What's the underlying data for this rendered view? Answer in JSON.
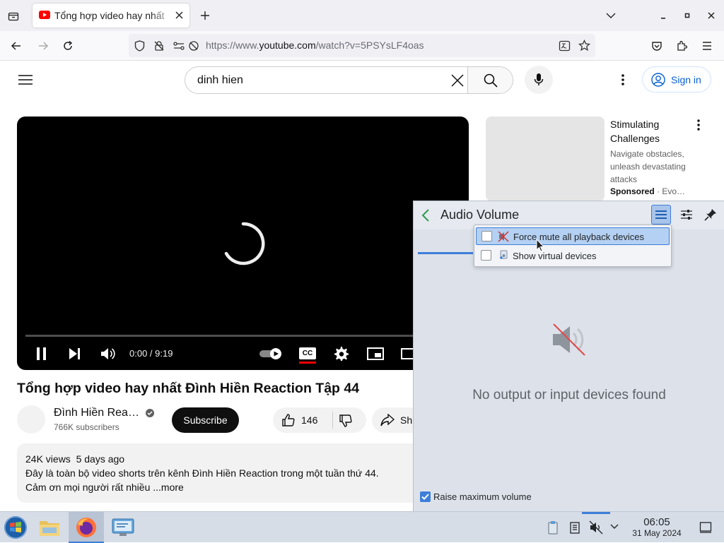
{
  "browser": {
    "tab_title": "Tổng hợp video hay nhất",
    "url_prefix": "https://www.",
    "url_domain": "youtube.com",
    "url_path": "/watch?v=5PSYsLF4oas"
  },
  "youtube": {
    "search_value": "dinh hien",
    "sign_in": "Sign in",
    "player": {
      "time": "0:00 / 9:19",
      "cc_label": "CC"
    },
    "video_title": "Tổng hợp video hay nhất Đình Hiền Reaction Tập 44",
    "channel": {
      "name": "Đình Hiền Rea…",
      "subscribers": "766K subscribers",
      "subscribe": "Subscribe"
    },
    "actions": {
      "likes": "146",
      "share": "Sh"
    },
    "description": {
      "stats": "24K views  5 days ago",
      "line1": "Đây là toàn bộ video shorts trên kênh Đình Hiền Reaction trong một tuần thứ 44.",
      "line2": "Cảm ơn mọi người rất nhiều",
      "more": " ...more"
    },
    "ad": {
      "title": "Stimulating Challenges",
      "body": "Navigate obstacles, unleash devastating attacks",
      "sponsored": "Sponsored",
      "advertiser": " · Evo…"
    }
  },
  "plasma": {
    "popup_title": "Audio Volume",
    "menu": {
      "force_mute": "Force mute all playback devices",
      "show_virtual": "Show virtual devices"
    },
    "empty_message": "No output or input devices found",
    "raise_max_volume": "Raise maximum volume",
    "raise_max_checked": true
  },
  "taskbar": {
    "time": "06:05",
    "date": "31 May 2024"
  },
  "colors": {
    "accent": "#3d7ed9",
    "youtube_red": "#ff0000",
    "sponsored": "#0f0f0f"
  }
}
